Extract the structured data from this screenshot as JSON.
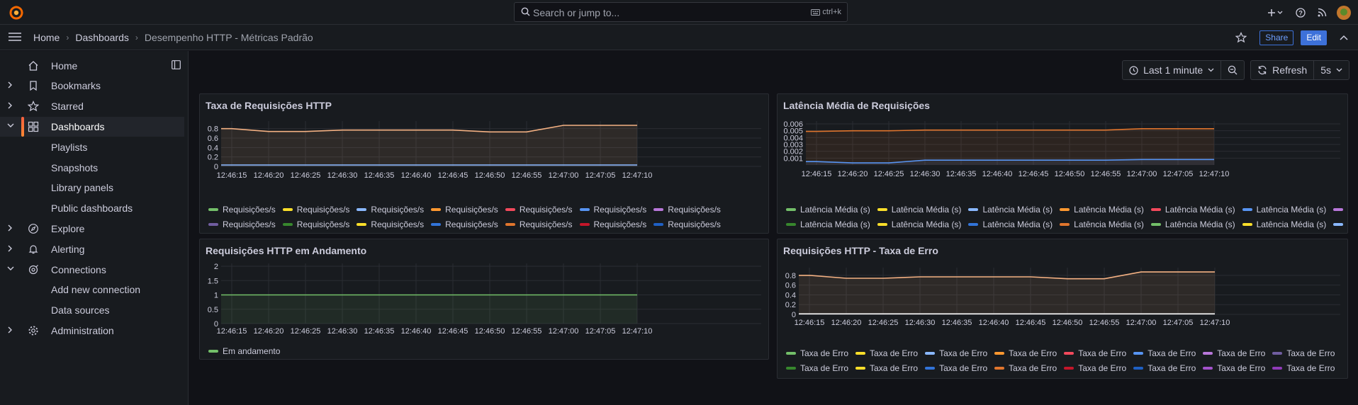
{
  "topbar": {
    "search_placeholder": "Search or jump to...",
    "search_shortcut": "ctrl+k",
    "icons": [
      "plus-icon",
      "help-icon",
      "rss-icon",
      "avatar"
    ]
  },
  "breadcrumbs": [
    "Home",
    "Dashboards",
    "Desempenho HTTP - Métricas Padrão"
  ],
  "actions": {
    "share": "Share",
    "edit": "Edit"
  },
  "sidebar": {
    "items": [
      {
        "label": "Home",
        "icon": "home-icon",
        "expand": ""
      },
      {
        "label": "Bookmarks",
        "icon": "bookmark-icon",
        "expand": "collapsed"
      },
      {
        "label": "Starred",
        "icon": "star-icon",
        "expand": "collapsed"
      },
      {
        "label": "Dashboards",
        "icon": "dashboards-icon",
        "expand": "expanded",
        "active": true
      },
      {
        "label": "Playlists",
        "sub": true
      },
      {
        "label": "Snapshots",
        "sub": true
      },
      {
        "label": "Library panels",
        "sub": true
      },
      {
        "label": "Public dashboards",
        "sub": true
      },
      {
        "label": "Explore",
        "icon": "compass-icon",
        "expand": "collapsed"
      },
      {
        "label": "Alerting",
        "icon": "bell-icon",
        "expand": "collapsed"
      },
      {
        "label": "Connections",
        "icon": "plug-icon",
        "expand": "expanded"
      },
      {
        "label": "Add new connection",
        "sub": true
      },
      {
        "label": "Data sources",
        "sub": true
      },
      {
        "label": "Administration",
        "icon": "cog-icon",
        "expand": "collapsed"
      }
    ]
  },
  "time_controls": {
    "range": "Last 1 minute",
    "refresh": "Refresh",
    "interval": "5s"
  },
  "x_ticks": [
    "12:46:15",
    "12:46:20",
    "12:46:25",
    "12:46:30",
    "12:46:35",
    "12:46:40",
    "12:46:45",
    "12:46:50",
    "12:46:55",
    "12:47:00",
    "12:47:05",
    "12:47:10"
  ],
  "panels": {
    "p1": {
      "title": "Taxa de Requisições HTTP",
      "legend_label": "Requisições/s",
      "legend_colors": [
        "#73bf69",
        "#fade2a",
        "#8ab8ff",
        "#ff9830",
        "#f2495c",
        "#5794f2",
        "#b877d9",
        "#705da0",
        "#37872d",
        "#fade2a",
        "#3274d9",
        "#e0752d",
        "#c4162a",
        "#1f60c4"
      ]
    },
    "p2": {
      "title": "Latência Média de Requisições",
      "legend_label": "Latência Média (s)",
      "legend_colors": [
        "#73bf69",
        "#fade2a",
        "#8ab8ff",
        "#ff9830",
        "#f2495c",
        "#5794f2",
        "#b877d9",
        "#705da0",
        "#37872d",
        "#fade2a",
        "#3274d9",
        "#e0752d"
      ]
    },
    "p3": {
      "title": "Requisições HTTP em Andamento",
      "legend_label": "Em andamento",
      "legend_colors": [
        "#73bf69"
      ]
    },
    "p4": {
      "title": "Requisições HTTP - Taxa de Erro",
      "legend_label": "Taxa de Erro",
      "legend_colors": [
        "#73bf69",
        "#fade2a",
        "#8ab8ff",
        "#ff9830",
        "#f2495c",
        "#5794f2",
        "#b877d9",
        "#705da0",
        "#37872d",
        "#fade2a",
        "#3274d9",
        "#e0752d",
        "#c4162a",
        "#1f60c4",
        "#a352cc",
        "#8f3bb8"
      ]
    }
  },
  "chart_data": [
    {
      "type": "line",
      "title": "Taxa de Requisições HTTP",
      "x": [
        "12:46:15",
        "12:46:20",
        "12:46:25",
        "12:46:30",
        "12:46:35",
        "12:46:40",
        "12:46:45",
        "12:46:50",
        "12:46:55",
        "12:47:00",
        "12:47:05",
        "12:47:10"
      ],
      "yticks": [
        "0",
        "0.2",
        "0.4",
        "0.6",
        "0.8"
      ],
      "ylim": [
        0,
        0.9
      ],
      "series": [
        {
          "name": "Requisições/s",
          "color": "#f4b183",
          "values": [
            0.8,
            0.74,
            0.74,
            0.77,
            0.77,
            0.77,
            0.77,
            0.73,
            0.73,
            0.87,
            0.87,
            0.87
          ]
        },
        {
          "name": "Requisições/s",
          "color": "#8ab8ff",
          "values": [
            0.03,
            0.03,
            0.03,
            0.03,
            0.03,
            0.03,
            0.03,
            0.03,
            0.03,
            0.03,
            0.03,
            0.03
          ]
        }
      ]
    },
    {
      "type": "line",
      "title": "Latência Média de Requisições",
      "x": [
        "12:46:15",
        "12:46:20",
        "12:46:25",
        "12:46:30",
        "12:46:35",
        "12:46:40",
        "12:46:45",
        "12:46:50",
        "12:46:55",
        "12:47:00",
        "12:47:05",
        "12:47:10"
      ],
      "yticks": [
        "0.001",
        "0.002",
        "0.003",
        "0.004",
        "0.005",
        "0.006"
      ],
      "ylim": [
        0,
        0.006
      ],
      "series": [
        {
          "name": "Latência Média (s)",
          "color": "#e0752d",
          "values": [
            0.0049,
            0.005,
            0.005,
            0.0051,
            0.0051,
            0.0051,
            0.0051,
            0.0051,
            0.0051,
            0.0053,
            0.0053,
            0.0053
          ]
        },
        {
          "name": "Latência Média (s)",
          "color": "#5794f2",
          "values": [
            0.0005,
            0.0003,
            0.0003,
            0.0007,
            0.0007,
            0.0007,
            0.0007,
            0.0007,
            0.0007,
            0.0008,
            0.0008,
            0.0008
          ]
        }
      ]
    },
    {
      "type": "line",
      "title": "Requisições HTTP em Andamento",
      "x": [
        "12:46:15",
        "12:46:20",
        "12:46:25",
        "12:46:30",
        "12:46:35",
        "12:46:40",
        "12:46:45",
        "12:46:50",
        "12:46:55",
        "12:47:00",
        "12:47:05",
        "12:47:10"
      ],
      "yticks": [
        "0",
        "0.5",
        "1",
        "1.5",
        "2"
      ],
      "ylim": [
        0,
        2
      ],
      "series": [
        {
          "name": "Em andamento",
          "color": "#73bf69",
          "values": [
            1,
            1,
            1,
            1,
            1,
            1,
            1,
            1,
            1,
            1,
            1,
            1
          ]
        }
      ]
    },
    {
      "type": "line",
      "title": "Requisições HTTP - Taxa de Erro",
      "x": [
        "12:46:15",
        "12:46:20",
        "12:46:25",
        "12:46:30",
        "12:46:35",
        "12:46:40",
        "12:46:45",
        "12:46:50",
        "12:46:55",
        "12:47:00",
        "12:47:05",
        "12:47:10"
      ],
      "yticks": [
        "0",
        "0.2",
        "0.4",
        "0.6",
        "0.8"
      ],
      "ylim": [
        0,
        0.9
      ],
      "series": [
        {
          "name": "Taxa de Erro",
          "color": "#f4b183",
          "values": [
            0.8,
            0.74,
            0.74,
            0.77,
            0.77,
            0.77,
            0.77,
            0.73,
            0.73,
            0.87,
            0.87,
            0.87
          ]
        },
        {
          "name": "Taxa de Erro",
          "color": "#ffffff",
          "values": [
            0.01,
            0.01,
            0.01,
            0.01,
            0.01,
            0.01,
            0.01,
            0.01,
            0.01,
            0.01,
            0.01,
            0.01
          ]
        }
      ]
    }
  ]
}
